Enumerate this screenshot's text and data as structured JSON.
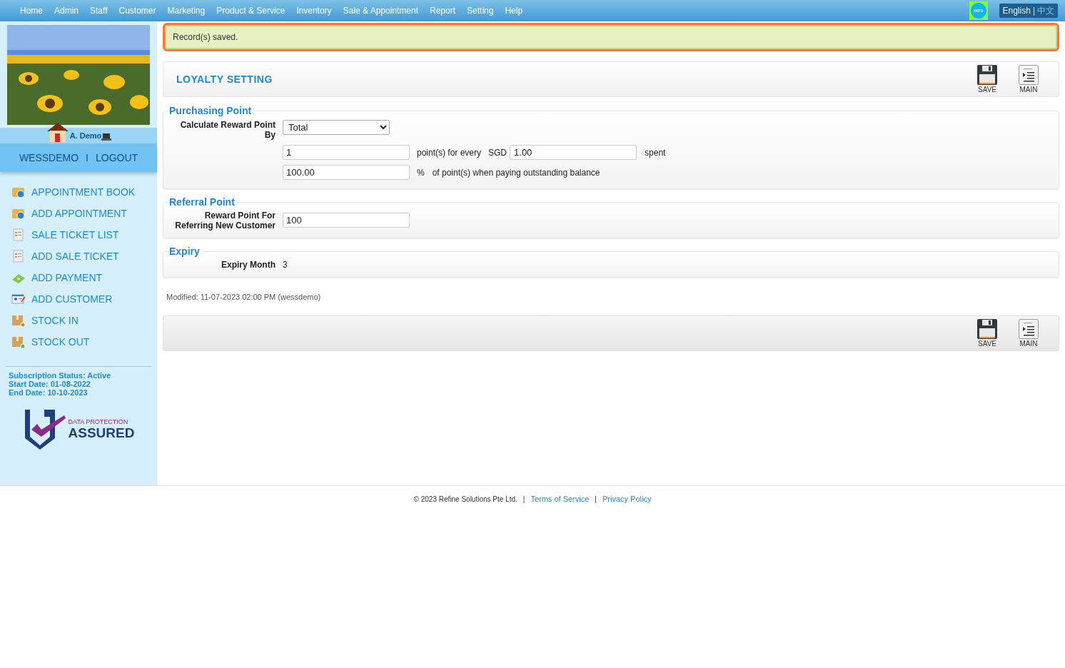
{
  "nav": {
    "items": [
      "Home",
      "Admin",
      "Staff",
      "Customer",
      "Marketing",
      "Product & Service",
      "Inventory",
      "Sale & Appointment",
      "Report",
      "Setting",
      "Help"
    ],
    "xero": "xero",
    "languages": [
      {
        "label": "English",
        "selected": true
      },
      {
        "label": "中文",
        "selected": false
      }
    ],
    "language_separator": "|"
  },
  "sidebar": {
    "user": "A. Demo",
    "account": "WESSDEMO",
    "separator": "I",
    "logout": "LOGOUT",
    "menu": [
      {
        "label": "APPOINTMENT BOOK",
        "kind": "calendar"
      },
      {
        "label": "ADD APPOINTMENT",
        "kind": "calendar"
      },
      {
        "label": "SALE TICKET LIST",
        "kind": "ticket"
      },
      {
        "label": "ADD SALE TICKET",
        "kind": "ticket"
      },
      {
        "label": "ADD PAYMENT",
        "kind": "payment"
      },
      {
        "label": "ADD CUSTOMER",
        "kind": "customer"
      },
      {
        "label": "STOCK IN",
        "kind": "stock-in"
      },
      {
        "label": "STOCK OUT",
        "kind": "stock-out"
      }
    ],
    "subscription": [
      "Subscription Status: Active",
      "Start Date: 01-08-2022",
      "End Date: 10-10-2023"
    ],
    "badge": {
      "top": "DATA PROTECTION",
      "bottom": "ASSURED"
    }
  },
  "alert": "Record(s) saved.",
  "header": {
    "title": "LOYALTY SETTING",
    "buttons": [
      {
        "label": "SAVE",
        "kind": "save"
      },
      {
        "label": "MAIN",
        "kind": "main"
      }
    ]
  },
  "purchasing": {
    "legend": "Purchasing Point",
    "calc_label": "Calculate Reward Point By",
    "calc_value": "Total",
    "points": "1",
    "for_every": "point(s) for every",
    "currency": "SGD",
    "amount": "1.00",
    "spent": "spent",
    "percent": "100.00",
    "percent_sign": "%",
    "percent_text": "of point(s) when paying outstanding balance"
  },
  "referral": {
    "legend": "Referral Point",
    "label": "Reward Point For Referring New Customer",
    "value": "100"
  },
  "expiry": {
    "legend": "Expiry",
    "label": "Expiry Month",
    "value": "3"
  },
  "modified": "Modified: 11-07-2023 02:00 PM (wessdemo)",
  "footer_buttons": [
    {
      "label": "SAVE",
      "kind": "save"
    },
    {
      "label": "MAIN",
      "kind": "main"
    }
  ],
  "footer": {
    "copyright": "© 2023 Refine Solutions Pte Ltd.",
    "links": [
      "Terms of Service",
      "Privacy Policy"
    ],
    "separator": "|"
  }
}
